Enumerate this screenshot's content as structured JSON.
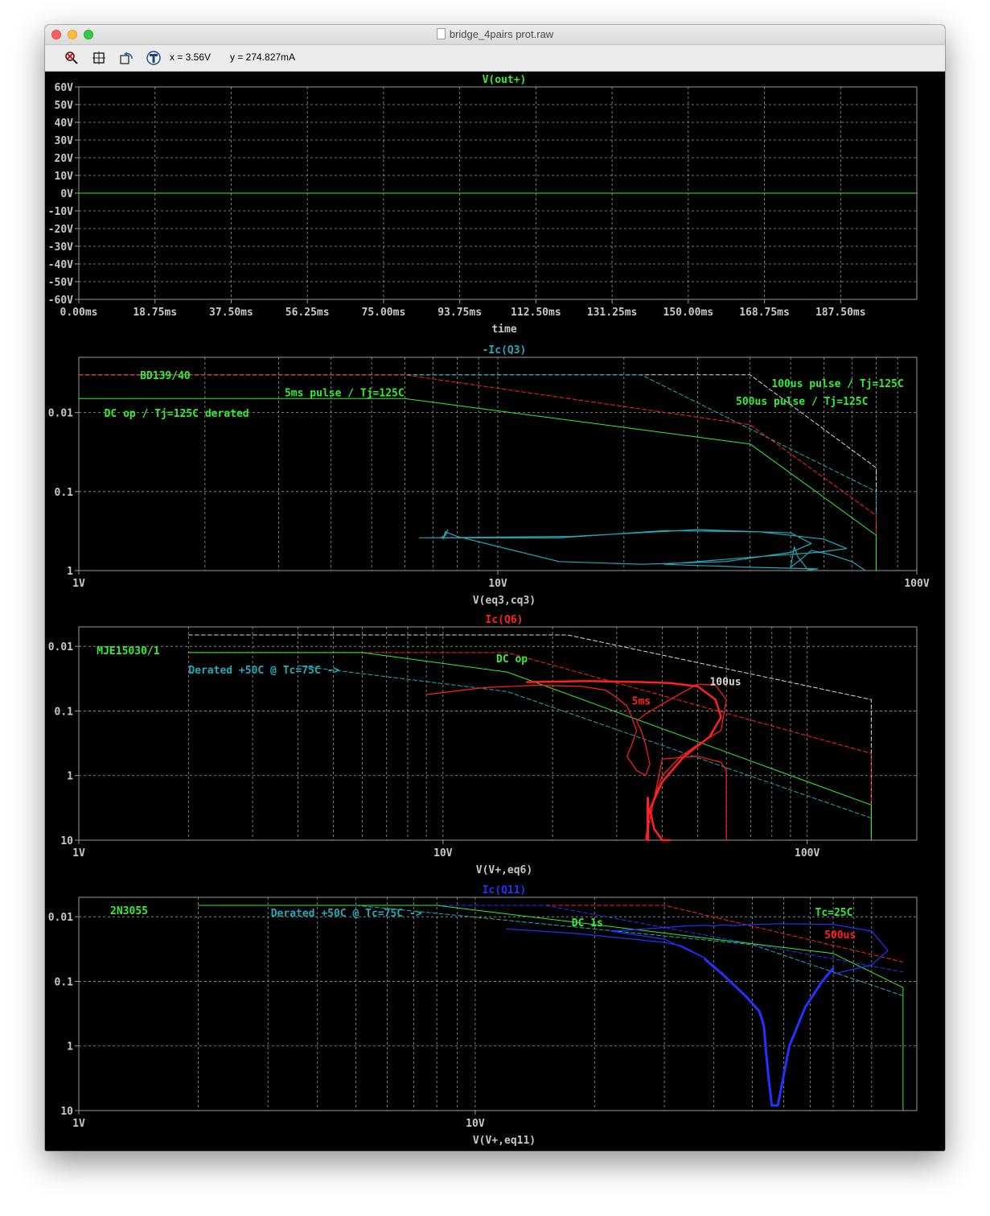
{
  "window": {
    "title": "bridge_4pairs prot.raw",
    "icons": [
      "zoom-cancel-icon",
      "zoom-fit-icon",
      "undo-zoom-icon",
      "probe-icon"
    ],
    "cursor_x": "x = 3.56V",
    "cursor_y": "y = 274.827mA"
  },
  "colors": {
    "background": "#000000",
    "grid": "#9a9a9a",
    "axis_text": "#c8c8c8",
    "green": "#33ee33",
    "cyan": "#22aab8",
    "red": "#ff2020",
    "white": "#d8d8d8",
    "blue": "#2233ff"
  },
  "chart_data": [
    {
      "type": "line",
      "title": "V(out+)",
      "xlabel": "time",
      "ylabel": "",
      "xlim": [
        0,
        206.25
      ],
      "ylim": [
        -60,
        60
      ],
      "xticks": [
        "0.00ms",
        "18.75ms",
        "37.50ms",
        "56.25ms",
        "75.00ms",
        "93.75ms",
        "112.50ms",
        "131.25ms",
        "150.00ms",
        "168.75ms",
        "187.50ms"
      ],
      "yticks": [
        "60V",
        "50V",
        "40V",
        "30V",
        "20V",
        "10V",
        "0V",
        "-10V",
        "-20V",
        "-30V",
        "-40V",
        "-50V",
        "-60V"
      ],
      "series": [
        {
          "name": "V(out+)",
          "color": "#33ee33",
          "x": [
            0,
            206.25
          ],
          "y": [
            0,
            0
          ]
        }
      ]
    },
    {
      "type": "line",
      "title": "-Ic(Q3)",
      "xlabel": "V(eq3,cq3)",
      "log_x": true,
      "log_y": true,
      "xlim": [
        1,
        100
      ],
      "ylim": [
        0.01,
        5
      ],
      "xticks": [
        "1V",
        "10V",
        "100V"
      ],
      "yticks": [
        "1",
        "0.1",
        "0.01"
      ],
      "annotations": [
        {
          "text": "BD139/40",
          "color": "#33ee33",
          "x": 1.4,
          "y": 2.65
        },
        {
          "text": "5ms pulse / Tj=125C",
          "color": "#33ee33",
          "x": 3.1,
          "y": 1.6
        },
        {
          "text": "DC op / Tj=125C derated",
          "color": "#33ee33",
          "x": 1.15,
          "y": 0.88
        },
        {
          "text": "100us pulse / Tj=125C",
          "color": "#33ee33",
          "x": 45,
          "y": 2.1
        },
        {
          "text": "500us pulse / Tj=125C",
          "color": "#33ee33",
          "x": 37,
          "y": 1.25
        }
      ],
      "series": [
        {
          "color": "#d8d8d8",
          "dash": true,
          "x": [
            1,
            40,
            80,
            80
          ],
          "y": [
            3,
            3,
            0.2,
            0.01
          ]
        },
        {
          "color": "#22aab8",
          "dash": true,
          "x": [
            1,
            22,
            80,
            80
          ],
          "y": [
            3,
            3,
            0.1,
            0.01
          ]
        },
        {
          "color": "#ff2020",
          "dash": true,
          "x": [
            1,
            6,
            40,
            80,
            80
          ],
          "y": [
            3,
            3,
            0.7,
            0.05,
            0.01
          ]
        },
        {
          "color": "#33ee33",
          "dash": false,
          "x": [
            1,
            6,
            40,
            80,
            80
          ],
          "y": [
            1.5,
            1.5,
            0.4,
            0.028,
            0.01
          ]
        },
        {
          "color": "#22aab8",
          "dash": false,
          "width": 1.2,
          "x": [
            6.5,
            15,
            30,
            50,
            56,
            50,
            35,
            22,
            14,
            8,
            7.5,
            7.4,
            7.6,
            7.5,
            7.3,
            14,
            25,
            42,
            60,
            68,
            58,
            42,
            30,
            25,
            40,
            58,
            55,
            52,
            51,
            50,
            53,
            56,
            62,
            70,
            75
          ],
          "y": [
            0.026,
            0.027,
            0.033,
            0.03,
            0.022,
            0.017,
            0.013,
            0.012,
            0.013,
            0.027,
            0.031,
            0.025,
            0.033,
            0.028,
            0.026,
            0.026,
            0.032,
            0.031,
            0.025,
            0.019,
            0.017,
            0.015,
            0.013,
            0.012,
            0.011,
            0.0105,
            0.0102,
            0.015,
            0.02,
            0.011,
            0.014,
            0.018,
            0.016,
            0.013,
            0.0102
          ]
        }
      ]
    },
    {
      "type": "line",
      "title": "Ic(Q6)",
      "xlabel": "V(V+,eq6)",
      "log_x": true,
      "log_y": true,
      "xlim": [
        1,
        200
      ],
      "ylim": [
        0.01,
        20
      ],
      "xticks": [
        "1V",
        "10V",
        "100V"
      ],
      "yticks": [
        "10",
        "1",
        "0.1",
        "0.01"
      ],
      "annotations": [
        {
          "text": "MJE15030/1",
          "color": "#33ee33",
          "x": 1.12,
          "y": 7.5
        },
        {
          "text": "DC op",
          "color": "#33ee33",
          "x": 14,
          "y": 5.7
        },
        {
          "text": "Derated +50C @ Tc=75C ->",
          "color": "#22aab8",
          "x": 2,
          "y": 3.8
        },
        {
          "text": "100us",
          "color": "#d8d8d8",
          "x": 54,
          "y": 2.5
        },
        {
          "text": "5ms",
          "color": "#ff2020",
          "x": 33,
          "y": 1.25
        }
      ],
      "series": [
        {
          "color": "#d8d8d8",
          "dash": true,
          "x": [
            2,
            22,
            150,
            150
          ],
          "y": [
            15,
            15,
            1.5,
            0.01
          ]
        },
        {
          "color": "#ff2020",
          "dash": true,
          "x": [
            2,
            15,
            150,
            150
          ],
          "y": [
            8,
            8,
            0.22,
            0.01
          ]
        },
        {
          "color": "#33ee33",
          "dash": false,
          "x": [
            2,
            6,
            15,
            150,
            150
          ],
          "y": [
            8,
            8,
            4,
            0.035,
            0.01
          ]
        },
        {
          "color": "#22aab8",
          "dash": true,
          "x": [
            4,
            15,
            150
          ],
          "y": [
            5,
            2,
            0.022
          ]
        },
        {
          "color": "#ff2020",
          "dash": false,
          "width": 1.2,
          "x": [
            9,
            13,
            18,
            24,
            28,
            30,
            32,
            33,
            34,
            33,
            32,
            34,
            36,
            37,
            36,
            35,
            34,
            36,
            42,
            50,
            56,
            60,
            58,
            50,
            45,
            40,
            37,
            36,
            40,
            50,
            58,
            60,
            60
          ],
          "y": [
            1.8,
            2.3,
            2.5,
            2.4,
            2.1,
            1.6,
            1.2,
            0.8,
            0.5,
            0.3,
            0.2,
            0.12,
            0.1,
            0.15,
            0.3,
            0.5,
            0.7,
            0.9,
            1.5,
            2.6,
            2.5,
            1.5,
            0.5,
            0.3,
            0.2,
            0.1,
            0.03,
            0.01,
            0.18,
            0.2,
            0.16,
            0.12,
            0.01
          ]
        },
        {
          "color": "#ff2020",
          "dash": false,
          "width": 2.5,
          "x": [
            17,
            25,
            35,
            42,
            50,
            56,
            58,
            54,
            46,
            40,
            37,
            38,
            40,
            41,
            42
          ],
          "y": [
            2.8,
            2.9,
            2.8,
            2.7,
            2.4,
            1.5,
            0.8,
            0.4,
            0.2,
            0.08,
            0.03,
            0.015,
            0.01,
            0.01,
            0.01
          ]
        },
        {
          "color": "#ff2020",
          "dash": false,
          "width": 3,
          "x": [
            36.5,
            36.5
          ],
          "y": [
            0.045,
            0.01
          ]
        }
      ]
    },
    {
      "type": "line",
      "title": "Ic(Q11)",
      "xlabel": "V(V+,eq11)",
      "log_x": true,
      "log_y": true,
      "xlim": [
        1,
        130
      ],
      "ylim": [
        0.01,
        20
      ],
      "xticks": [
        "1V",
        "10V"
      ],
      "yticks": [
        "10",
        "1",
        "0.1",
        "0.01"
      ],
      "annotations": [
        {
          "text": "2N3055",
          "color": "#33ee33",
          "x": 1.2,
          "y": 11
        },
        {
          "text": "Derated +50C @ Tc=75C ->",
          "color": "#22aab8",
          "x": 3.05,
          "y": 10
        },
        {
          "text": "DC 1s",
          "color": "#33ee33",
          "x": 17.5,
          "y": 7.1
        },
        {
          "text": "Tc=25C",
          "color": "#33ee33",
          "x": 72,
          "y": 10.3
        },
        {
          "text": "500us",
          "color": "#ff2020",
          "x": 76,
          "y": 4.6
        }
      ],
      "series": [
        {
          "color": "#ff2020",
          "dash": true,
          "x": [
            2,
            30,
            120
          ],
          "y": [
            15,
            15,
            2.0
          ]
        },
        {
          "color": "#2233ff",
          "dash": true,
          "x": [
            2,
            15,
            120
          ],
          "y": [
            15,
            15,
            1.4
          ]
        },
        {
          "color": "#33ee33",
          "dash": false,
          "x": [
            2,
            8,
            40,
            80,
            120,
            120
          ],
          "y": [
            15,
            15,
            4.5,
            2.7,
            0.8,
            0.01
          ]
        },
        {
          "color": "#22aab8",
          "dash": true,
          "x": [
            5,
            50,
            120
          ],
          "y": [
            15,
            3.7,
            0.6
          ]
        },
        {
          "color": "#2233ff",
          "dash": false,
          "width": 1.2,
          "x": [
            12,
            18,
            25,
            30,
            33,
            35,
            37,
            38,
            30,
            22,
            28,
            34,
            38,
            40,
            42,
            45,
            50,
            60,
            80,
            100,
            110,
            100,
            80
          ],
          "y": [
            6.5,
            5.5,
            4.5,
            4.0,
            3.6,
            3.0,
            2.5,
            2.3,
            4.5,
            6.0,
            6.6,
            7.2,
            7.4,
            7.2,
            7.5,
            7.3,
            7.6,
            7.8,
            7.6,
            6.0,
            3.0,
            1.8,
            1.3
          ]
        },
        {
          "color": "#2233ff",
          "dash": false,
          "width": 3,
          "x": [
            38,
            42,
            48,
            52,
            53,
            53.5,
            54,
            55,
            56,
            58,
            62,
            68,
            75,
            80
          ],
          "y": [
            2.2,
            1.3,
            0.6,
            0.35,
            0.25,
            0.2,
            0.1,
            0.03,
            0.012,
            0.012,
            0.1,
            0.4,
            1.0,
            1.6
          ]
        }
      ]
    }
  ]
}
